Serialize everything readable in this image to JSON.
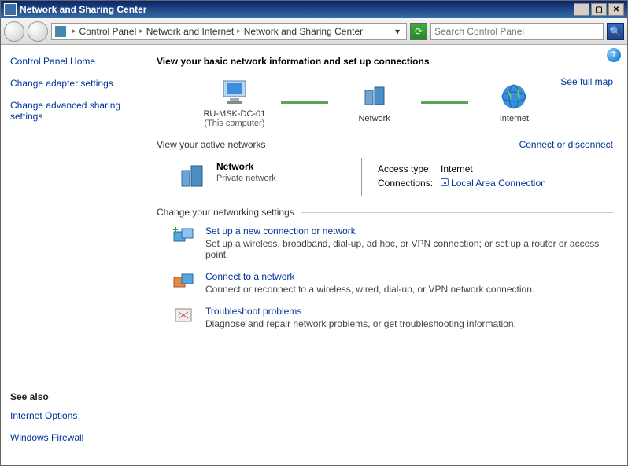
{
  "window": {
    "title": "Network and Sharing Center"
  },
  "breadcrumb": {
    "p1": "Control Panel",
    "p2": "Network and Internet",
    "p3": "Network and Sharing Center"
  },
  "search": {
    "placeholder": "Search Control Panel"
  },
  "leftnav": {
    "home": "Control Panel Home",
    "adapter": "Change adapter settings",
    "advanced": "Change advanced sharing settings"
  },
  "seealso": {
    "heading": "See also",
    "internet": "Internet Options",
    "firewall": "Windows Firewall"
  },
  "main": {
    "heading": "View your basic network information and set up connections",
    "seefullmap": "See full map",
    "map": {
      "this_label": "RU-MSK-DC-01",
      "this_sub": "(This computer)",
      "network_label": "Network",
      "internet_label": "Internet"
    },
    "active_hdr": "View your active networks",
    "connect_link": "Connect or disconnect",
    "network": {
      "name": "Network",
      "type": "Private network"
    },
    "access": {
      "type_lbl": "Access type:",
      "type_val": "Internet",
      "conn_lbl": "Connections:",
      "conn_val": "Local Area Connection"
    },
    "change_hdr": "Change your networking settings",
    "tasks": {
      "setup_ttl": "Set up a new connection or network",
      "setup_desc": "Set up a wireless, broadband, dial-up, ad hoc, or VPN connection; or set up a router or access point.",
      "connect_ttl": "Connect to a network",
      "connect_desc": "Connect or reconnect to a wireless, wired, dial-up, or VPN network connection.",
      "trouble_ttl": "Troubleshoot problems",
      "trouble_desc": "Diagnose and repair network problems, or get troubleshooting information."
    }
  }
}
